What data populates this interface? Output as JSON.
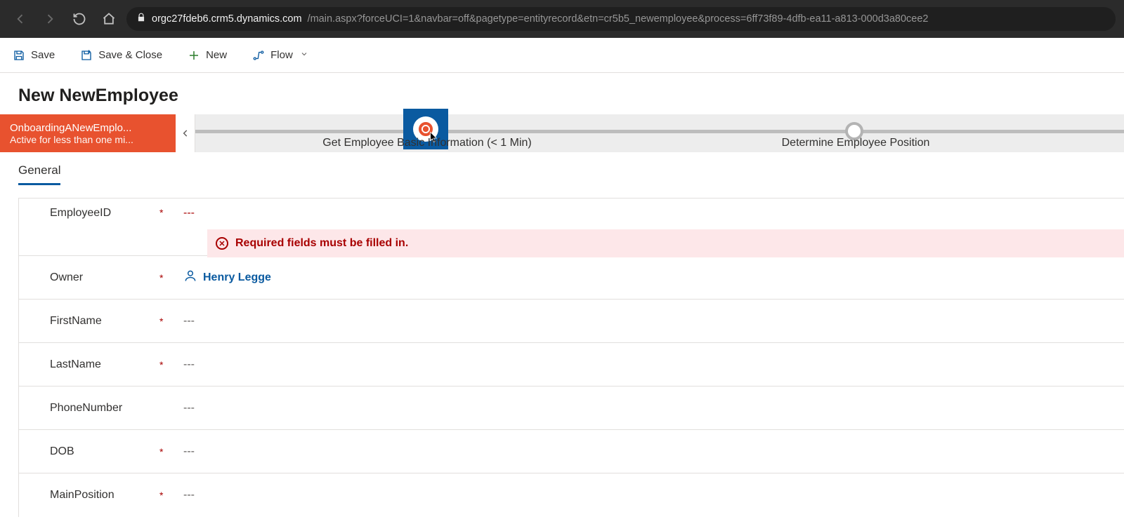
{
  "browser": {
    "domain": "orgc27fdeb6.crm5.dynamics.com",
    "path": "/main.aspx?forceUCI=1&navbar=off&pagetype=entityrecord&etn=cr5b5_newemployee&process=6ff73f89-4dfb-ea11-a813-000d3a80cee2"
  },
  "commands": {
    "save": "Save",
    "saveClose": "Save & Close",
    "new": "New",
    "flow": "Flow"
  },
  "page": {
    "title": "New NewEmployee"
  },
  "bpf": {
    "processName": "OnboardingANewEmplo...",
    "processSub": "Active for less than one mi...",
    "stages": [
      {
        "label": "Get Employee Basic Information  (< 1 Min)",
        "active": true
      },
      {
        "label": "Determine Employee Position",
        "active": false
      }
    ]
  },
  "tabs": [
    {
      "label": "General",
      "active": true
    }
  ],
  "form": {
    "errorMessage": "Required fields must be filled in.",
    "fields": [
      {
        "key": "employeeId",
        "label": "EmployeeID",
        "required": true,
        "value": "---",
        "error": true
      },
      {
        "key": "owner",
        "label": "Owner",
        "required": true,
        "lookup": "Henry Legge"
      },
      {
        "key": "firstName",
        "label": "FirstName",
        "required": true,
        "value": "---"
      },
      {
        "key": "lastName",
        "label": "LastName",
        "required": true,
        "value": "---"
      },
      {
        "key": "phone",
        "label": "PhoneNumber",
        "required": false,
        "value": "---"
      },
      {
        "key": "dob",
        "label": "DOB",
        "required": true,
        "value": "---"
      },
      {
        "key": "mainPos",
        "label": "MainPosition",
        "required": true,
        "value": "---"
      }
    ]
  }
}
